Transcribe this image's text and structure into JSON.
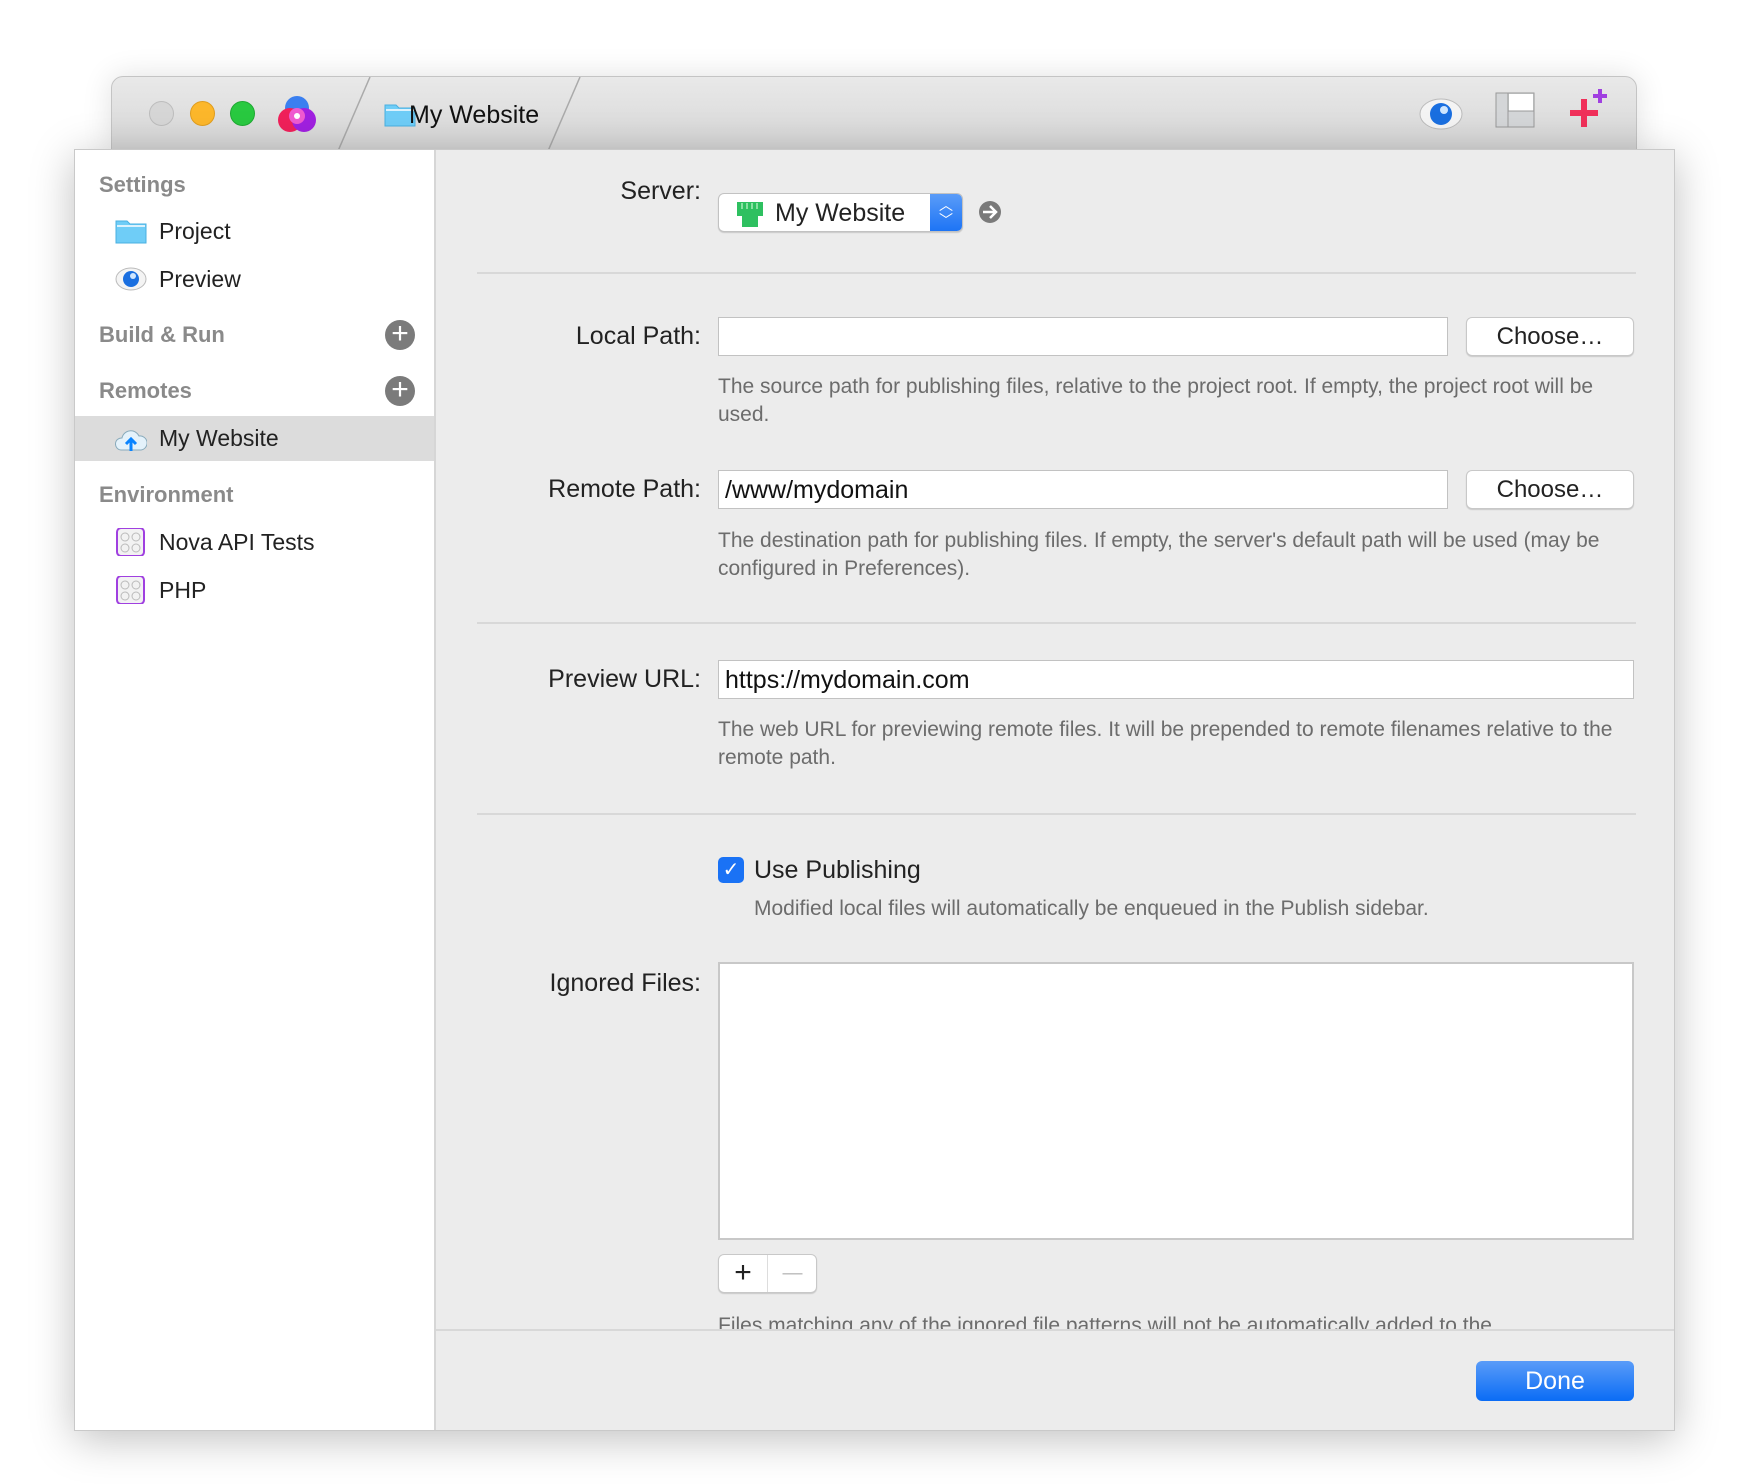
{
  "window": {
    "tab_title": "My Website",
    "toolbar_icons": [
      "eye-icon",
      "layout-icon",
      "sparkle-plus-icon"
    ]
  },
  "sidebar": {
    "sections": [
      {
        "title": "Settings",
        "items": [
          {
            "label": "Project",
            "icon": "folder-icon"
          },
          {
            "label": "Preview",
            "icon": "eye-icon"
          }
        ]
      },
      {
        "title": "Build & Run",
        "items": []
      },
      {
        "title": "Remotes",
        "items": [
          {
            "label": "My Website",
            "icon": "cloud-upload-icon",
            "selected": true
          }
        ]
      },
      {
        "title": "Environment",
        "items": [
          {
            "label": "Nova API Tests",
            "icon": "extension-icon"
          },
          {
            "label": "PHP",
            "icon": "extension-icon"
          }
        ]
      }
    ],
    "add_symbol": "+"
  },
  "form": {
    "server_label": "Server:",
    "server_value": "My Website",
    "local_path_label": "Local Path:",
    "local_path_value": "",
    "choose_label": "Choose…",
    "local_path_help": "The source path for publishing files, relative to the project root. If empty, the project root will be used.",
    "remote_path_label": "Remote Path:",
    "remote_path_value": "/www/mydomain",
    "remote_path_help": "The destination path for publishing files. If empty, the server's default path will be used (may be configured in Preferences).",
    "preview_url_label": "Preview URL:",
    "preview_url_value": "https://mydomain.com",
    "preview_url_help": "The web URL for previewing remote files. It will be prepended to remote filenames relative to the remote path.",
    "use_publishing_label": "Use Publishing",
    "use_publishing_checked": true,
    "use_publishing_help": "Modified local files will automatically be enqueued in the Publish sidebar.",
    "ignored_files_label": "Ignored Files:",
    "ignored_files": [],
    "add_label": "+",
    "remove_label": "—",
    "ignored_help": "Files matching any of the ignored file patterns will not be automatically added to the"
  },
  "footer": {
    "done_label": "Done"
  },
  "colors": {
    "accent": "#1a72f5",
    "close": "#d0d0d0",
    "minimize": "#fcb72b",
    "zoom": "#29c940"
  }
}
